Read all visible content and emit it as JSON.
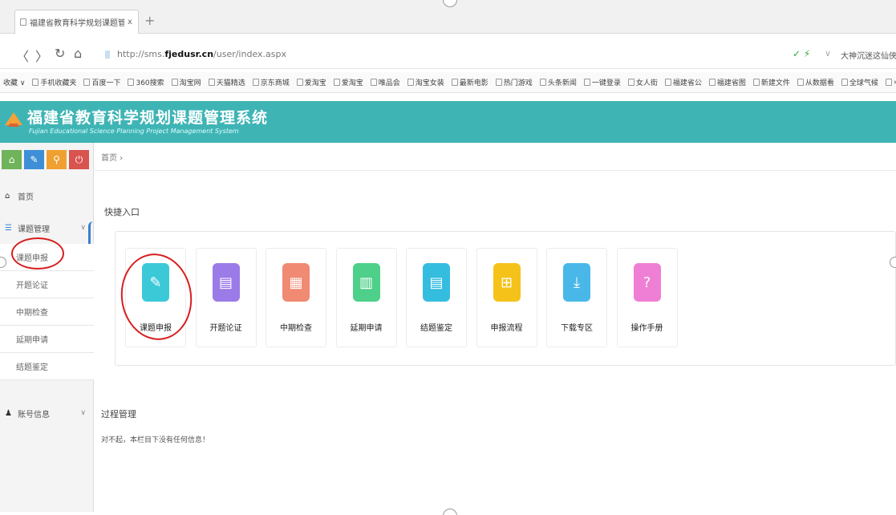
{
  "browser": {
    "tab_title": "福建省教育科学规划课题管理系",
    "tab_close": "x",
    "new_tab": "+",
    "back": "〈",
    "forward": "〉",
    "reload": "↻",
    "home": "⌂",
    "url_prefix": "http://sms.",
    "url_domain": "fjedusr.cn",
    "url_path": "/user/index.aspx",
    "addr_right_icons": "✓ ⚡",
    "addr_dropdown": "∨",
    "search_text": "大神沉迷这仙侠"
  },
  "bookmarks": [
    "收藏 ∨",
    "手机收藏夹",
    "百度一下",
    "360搜索",
    "淘宝网",
    "天猫精选",
    "京东商城",
    "爱淘宝",
    "爱淘宝",
    "唯品会",
    "淘宝女装",
    "最新电影",
    "热门游戏",
    "头条新闻",
    "一键登录",
    "女人街",
    "福建省公",
    "福建省图",
    "新建文件",
    "从数据看",
    "全球气候",
    "»"
  ],
  "app": {
    "title": "福建省教育科学规划课题管理系统",
    "subtitle": "Fujian Educational Science Planning Project Management System"
  },
  "sidebar": {
    "tools": [
      {
        "icon": "home-icon",
        "glyph": "⌂",
        "color": "#6fb35a"
      },
      {
        "icon": "pencil-icon",
        "glyph": "✎",
        "color": "#3e8fd6"
      },
      {
        "icon": "search-icon",
        "glyph": "⚲",
        "color": "#f0a030"
      },
      {
        "icon": "power-icon",
        "glyph": "⏻",
        "color": "#d9534f"
      }
    ],
    "home": "首页",
    "project_mgmt": "课题管理",
    "sub_items": [
      "课题申报",
      "开题论证",
      "中期检查",
      "延期申请",
      "结题鉴定"
    ],
    "account": "账号信息",
    "chevron": "∨"
  },
  "main": {
    "breadcrumb": "首页 ›",
    "quick_entry_title": "快捷入口",
    "tiles": [
      {
        "label": "课题申报",
        "color": "#3bc9d8",
        "icon": "edit-icon",
        "glyph": "✎"
      },
      {
        "label": "开题论证",
        "color": "#9b7be8",
        "icon": "document-icon",
        "glyph": "▤"
      },
      {
        "label": "中期检查",
        "color": "#f08a73",
        "icon": "document-search-icon",
        "glyph": "▦"
      },
      {
        "label": "延期申请",
        "color": "#4fd08a",
        "icon": "book-icon",
        "glyph": "▥"
      },
      {
        "label": "结题鉴定",
        "color": "#35bde0",
        "icon": "report-icon",
        "glyph": "▤"
      },
      {
        "label": "申报流程",
        "color": "#f5c21a",
        "icon": "flowchart-icon",
        "glyph": "⊞"
      },
      {
        "label": "下载专区",
        "color": "#49b8e8",
        "icon": "download-icon",
        "glyph": "⤓"
      },
      {
        "label": "操作手册",
        "color": "#ef7fd4",
        "icon": "help-icon",
        "glyph": "?"
      }
    ],
    "process_title": "过程管理",
    "empty_message": "对不起，本栏目下没有任何信息！"
  }
}
